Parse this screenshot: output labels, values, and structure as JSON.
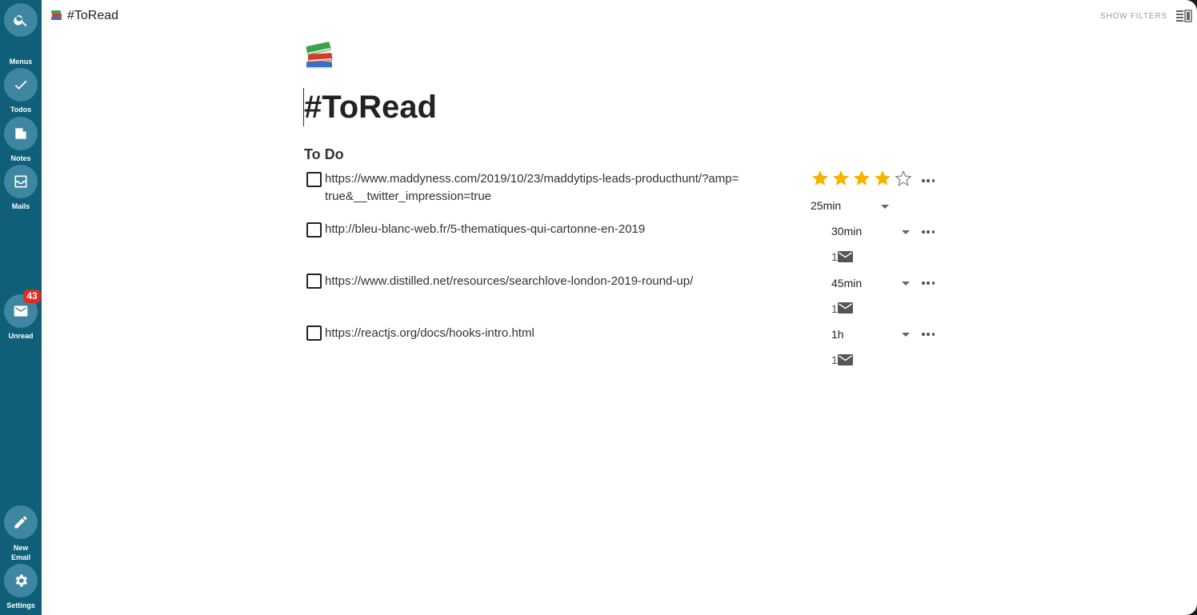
{
  "sidebar": {
    "items": [
      {
        "label": "Menus",
        "icon": "search-icon"
      },
      {
        "label": "Todos",
        "icon": "check-icon"
      },
      {
        "label": "Notes",
        "icon": "note-icon"
      },
      {
        "label": "Mails",
        "icon": "inbox-icon"
      },
      {
        "label": "Unread",
        "icon": "mail-icon",
        "badge": "43"
      },
      {
        "label_line1": "New",
        "label_line2": "Email",
        "icon": "pencil-icon"
      },
      {
        "label": "Settings",
        "icon": "gear-icon"
      }
    ]
  },
  "topbar": {
    "title": "#ToRead",
    "show_filters": "SHOW FILTERS",
    "icon": "books-icon"
  },
  "page": {
    "title": "#ToRead",
    "section": "To Do"
  },
  "tasks": [
    {
      "url": "https://www.maddyness.com/2019/10/23/maddytips-leads-producthunt/?amp=true&__twitter_impression=true",
      "rating": 4,
      "rating_max": 5,
      "duration": "25min"
    },
    {
      "url": "http://bleu-blanc-web.fr/5-thematiques-qui-cartonne-en-2019",
      "duration": "30min",
      "mail_count": "1"
    },
    {
      "url": "https://www.distilled.net/resources/searchlove-london-2019-round-up/",
      "duration": "45min",
      "mail_count": "1"
    },
    {
      "url": "https://reactjs.org/docs/hooks-intro.html",
      "duration": "1h",
      "mail_count": "1"
    }
  ],
  "colors": {
    "sidebar": "#0f5f78",
    "sidebar_button": "#3f87a0",
    "badge": "#e02b20",
    "star": "#f5b400"
  }
}
